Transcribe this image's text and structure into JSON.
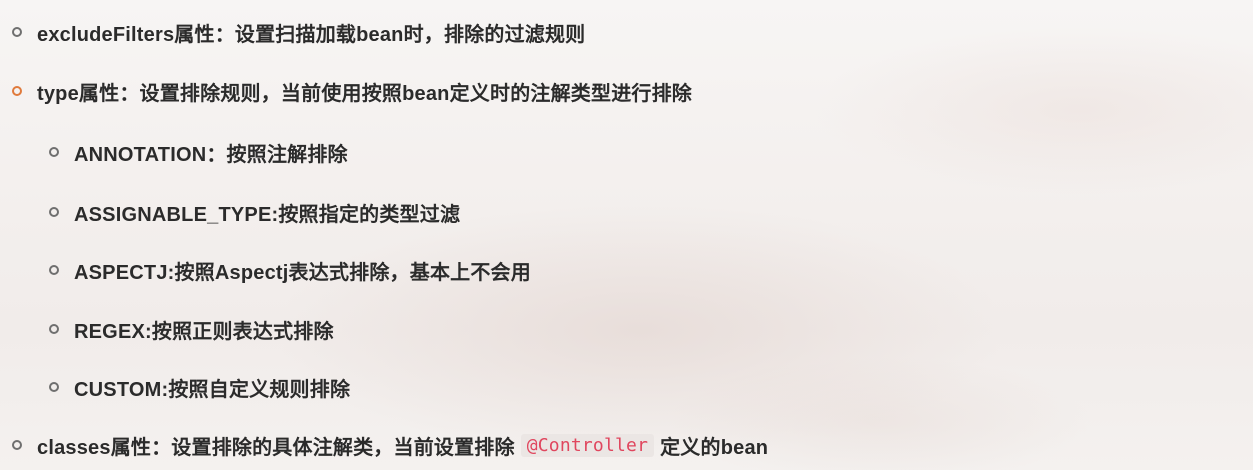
{
  "items": [
    {
      "text": "excludeFilters属性：设置扫描加载bean时，排除的过滤规则"
    },
    {
      "text": "type属性：设置排除规则，当前使用按照bean定义时的注解类型进行排除"
    },
    {
      "text": "ANNOTATION：按照注解排除"
    },
    {
      "text": "ASSIGNABLE_TYPE:按照指定的类型过滤"
    },
    {
      "text": "ASPECTJ:按照Aspectj表达式排除，基本上不会用"
    },
    {
      "text": "REGEX:按照正则表达式排除"
    },
    {
      "text": "CUSTOM:按照自定义规则排除"
    },
    {
      "text_before": "classes属性：设置排除的具体注解类，当前设置排除",
      "code": "@Controller",
      "text_after": "定义的bean"
    }
  ]
}
